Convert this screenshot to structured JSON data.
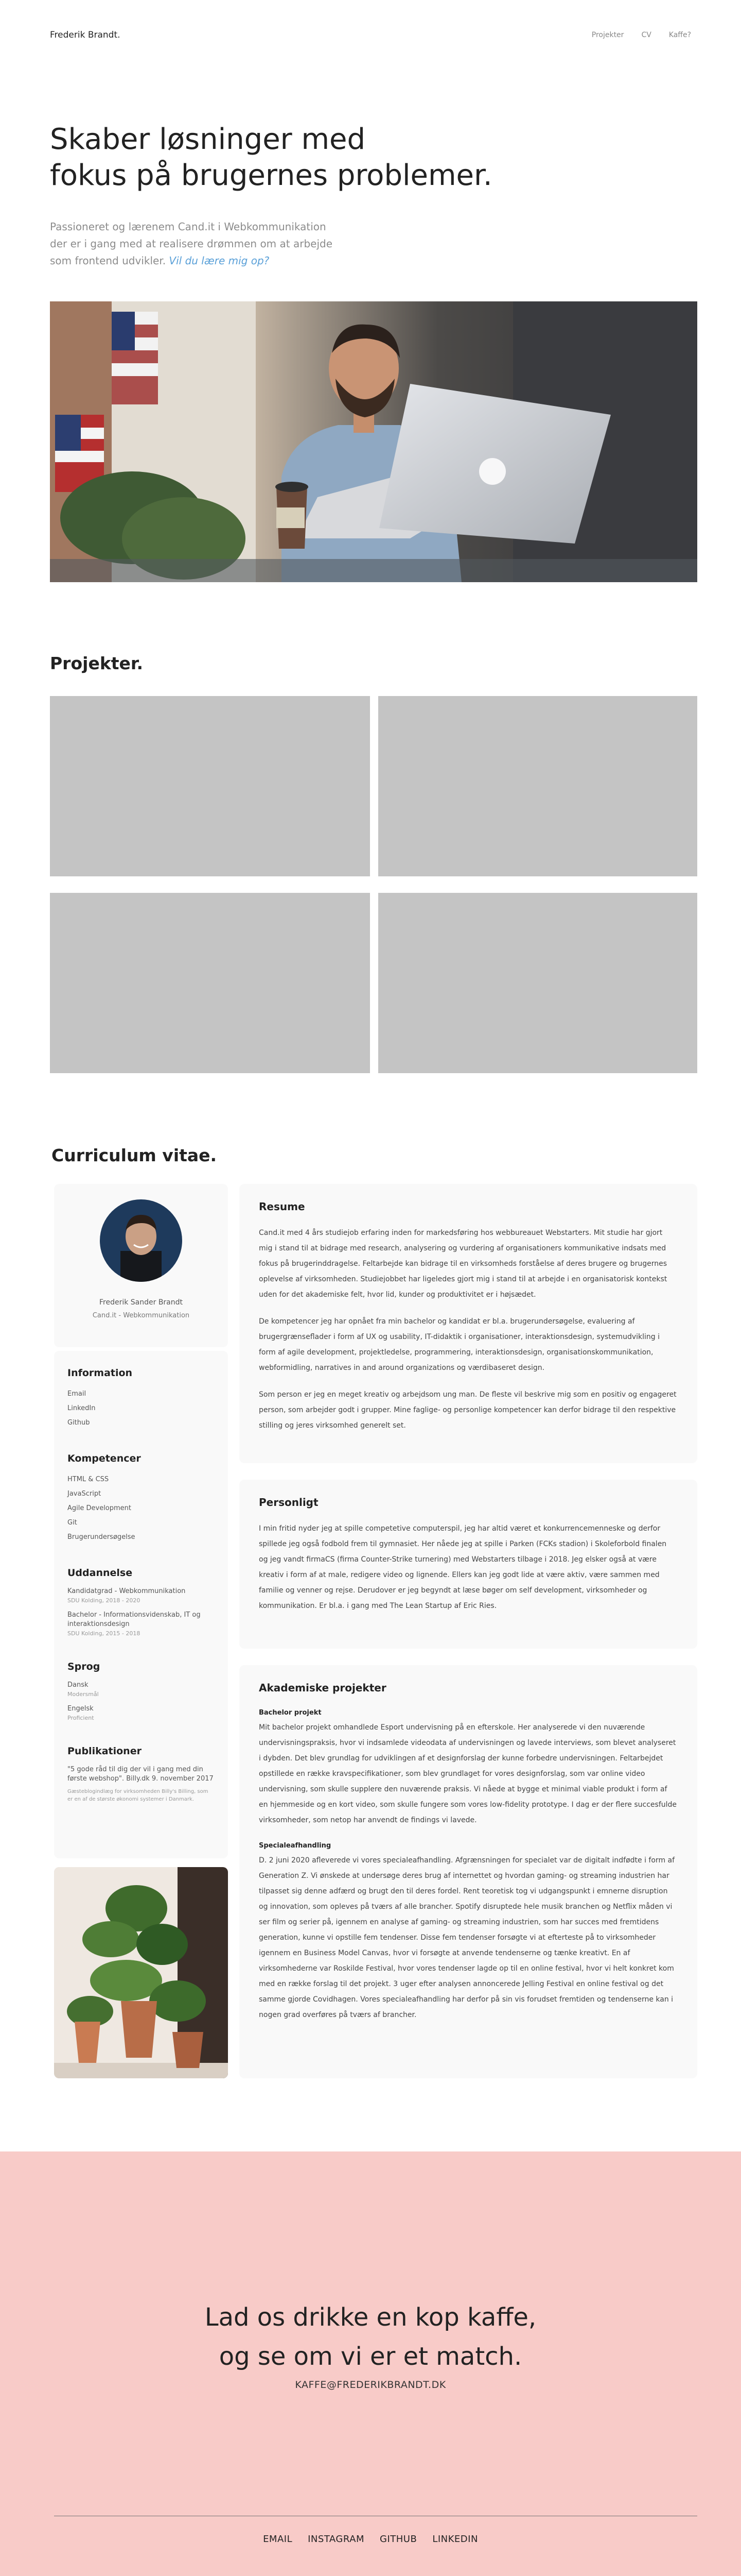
{
  "header": {
    "logo": "Frederik Brandt.",
    "nav": [
      "Projekter",
      "CV",
      "Kaffe?"
    ]
  },
  "hero": {
    "title_line1": "Skaber løsninger med",
    "title_line2": "fokus på brugernes problemer.",
    "subtitle": "Passioneret og lærenem Cand.it i Webkommunikation der er i gang med at realisere drømmen om at arbejde som frontend udvikler.",
    "subtitle_link": "Vil du lære mig op?"
  },
  "projects": {
    "title": "Projekter."
  },
  "cv": {
    "title": "Curriculum vitae.",
    "profile": {
      "name": "Frederik Sander Brandt",
      "degree": "Cand.it - Webkommunikation"
    },
    "information": {
      "heading": "Information",
      "items": [
        "Email",
        "LinkedIn",
        "Github"
      ]
    },
    "competencies": {
      "heading": "Kompetencer",
      "items": [
        "HTML & CSS",
        "JavaScript",
        "Agile Development",
        "Git",
        "Brugerundersøgelse"
      ]
    },
    "education": {
      "heading": "Uddannelse",
      "items": [
        {
          "title": "Kandidatgrad - Webkommunikation",
          "sub": "SDU Kolding, 2018 - 2020"
        },
        {
          "title": "Bachelor - Informationsvidenskab, IT og interaktionsdesign",
          "sub": "SDU Kolding, 2015 - 2018"
        }
      ]
    },
    "languages": {
      "heading": "Sprog",
      "items": [
        {
          "title": "Dansk",
          "sub": "Modersmål"
        },
        {
          "title": "Engelsk",
          "sub": "Proficient"
        }
      ]
    },
    "publications": {
      "heading": "Publikationer",
      "quote": "\"5 gode råd til dig der vil i gang med din første webshop\".",
      "author": "Billy.dk 9. november 2017",
      "desc": "Gæsteblogindlæg for virksomheden Billy's Billing, som er en af de største økonomi systemer i Danmark."
    },
    "resume": {
      "heading": "Resume",
      "p1": "Cand.it med 4 års studiejob erfaring inden for markedsføring hos webbureauet Webstarters. Mit studie har gjort mig i stand til at bidrage med research, analysering og vurdering af organisationers kommunikative indsats med fokus på brugerinddragelse. Feltarbejde kan bidrage til en virksomheds forståelse af deres brugere og brugernes oplevelse af virksomheden. Studiejobbet har ligeledes gjort mig i stand til at arbejde i en organisatorisk kontekst uden for det akademiske felt, hvor lid, kunder og produktivitet er i højsædet.",
      "p2": "De kompetencer jeg har opnået fra min bachelor og kandidat er bl.a. brugerundersøgelse, evaluering af brugergrænseflader i form af UX og usability, IT-didaktik i organisationer, interaktionsdesign, systemudvikling i form af agile development, projektledelse, programmering, interaktionsdesign, organisationskommunikation, webformidling, narratives in and around organizations og værdibaseret design.",
      "p3": "Som person er jeg en meget kreativ og arbejdsom ung man. De fleste vil beskrive mig som en positiv og engageret person, som arbejder godt i grupper. Mine faglige- og personlige kompetencer kan derfor bidrage til den respektive stilling og jeres virksomhed generelt set."
    },
    "personal": {
      "heading": "Personligt",
      "p1": "I min fritid nyder jeg at spille competetive computerspil, jeg har altid været et konkurrencemenneske og derfor spillede jeg også fodbold frem til gymnasiet. Her nåede jeg at spille i Parken (FCKs stadion) i Skoleforbold finalen og jeg vandt firmaCS (firma Counter-Strike turnering) med Webstarters tilbage i 2018. Jeg elsker også at være kreativ i form af at male, redigere video og lignende. Ellers kan jeg godt lide at være aktiv, være sammen med familie og venner og rejse. Derudover er jeg begyndt at læse bøger om self development, virksomheder og kommunikation. Er bl.a. i gang med The Lean Startup af Eric Ries."
    },
    "academic": {
      "heading": "Akademiske projekter",
      "bachelor_title": "Bachelor projekt",
      "bachelor_text": "Mit bachelor projekt omhandlede Esport undervisning på en efterskole. Her analyserede vi den nuværende undervisningspraksis, hvor vi indsamlede videodata af undervisningen og lavede interviews, som blevet analyseret i dybden. Det blev grundlag for udviklingen af et designforslag der kunne forbedre undervisningen. Feltarbejdet opstillede en række kravspecifikationer, som blev grundlaget for vores designforslag, som var online video undervisning, som skulle supplere den nuværende praksis. Vi nåede at bygge et minimal viable produkt i form af en hjemmeside og en kort video, som skulle fungere som vores low-fidelity prototype. I dag er der flere succesfulde virksomheder, som netop har anvendt de findings vi lavede.",
      "special_title": "Specialeafhandling",
      "special_text": "D. 2 juni 2020 afleverede vi vores specialeafhandling. Afgrænsningen for specialet var de digitalt indfødte i form af Generation Z. Vi ønskede at undersøge deres brug af internettet og hvordan gaming- og streaming industrien har tilpasset sig denne adfærd og brugt den til deres fordel. Rent teoretisk tog vi udgangspunkt i emnerne disruption og innovation, som opleves på tværs af alle brancher. Spotify disruptede hele musik branchen og Netflix måden vi ser film og serier på, igennem en analyse af gaming- og streaming industrien, som har succes med fremtidens generation, kunne vi opstille fem tendenser. Disse fem tendenser forsøgte vi at efterteste på to virksomheder igennem en Business Model Canvas, hvor vi forsøgte at anvende tendenserne og tænke kreativt. En af virksomhederne var Roskilde Festival, hvor vores tendenser lagde op til en online festival, hvor vi helt konkret kom med en række forslag til det projekt. 3 uger efter analysen annoncerede Jelling Festival en online festival og det samme gjorde Covidhagen. Vores specialeafhandling har derfor på sin vis forudset fremtiden og tendenserne kan i nogen grad overføres på tværs af brancher."
    }
  },
  "footer": {
    "cta_line1": "Lad os drikke en kop kaffe,",
    "cta_line2": "og se om vi er et match.",
    "email": "KAFFE@FREDERIKBRANDT.DK",
    "links": [
      "EMAIL",
      "INSTAGRAM",
      "GITHUB",
      "LINKEDIN"
    ]
  },
  "colors": {
    "accent_link": "#5aa0d8",
    "footer_bg": "#f8cbc8",
    "placeholder": "#c4c4c4"
  }
}
